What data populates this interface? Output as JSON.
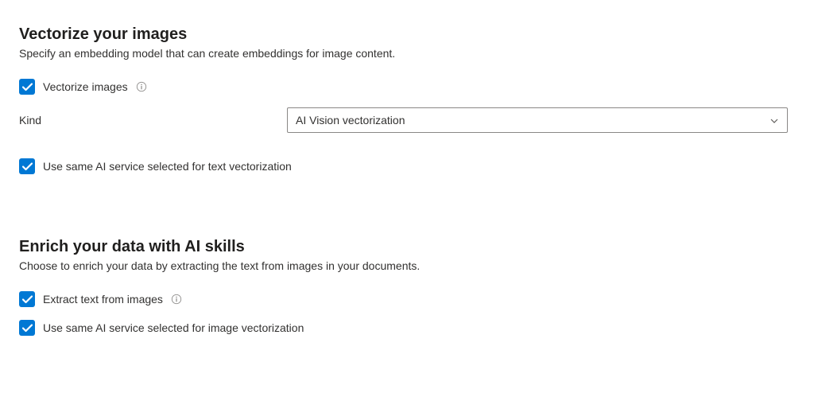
{
  "section1": {
    "title": "Vectorize your images",
    "subtitle": "Specify an embedding model that can create embeddings for image content.",
    "vectorize_checkbox": {
      "label": "Vectorize images",
      "checked": true
    },
    "kind_field": {
      "label": "Kind",
      "selected": "AI Vision vectorization"
    },
    "same_service_checkbox": {
      "label": "Use same AI service selected for text vectorization",
      "checked": true
    }
  },
  "section2": {
    "title": "Enrich your data with AI skills",
    "subtitle": "Choose to enrich your data by extracting the text from images in your documents.",
    "extract_checkbox": {
      "label": "Extract text from images",
      "checked": true
    },
    "same_service_checkbox": {
      "label": "Use same AI service selected for image vectorization",
      "checked": true
    }
  }
}
